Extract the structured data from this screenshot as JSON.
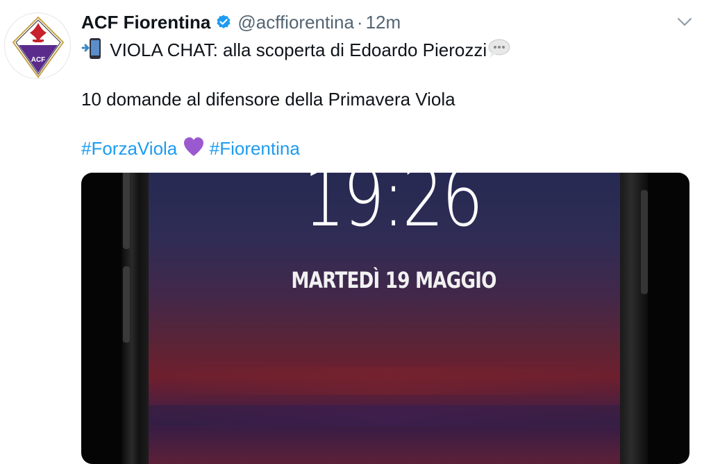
{
  "tweet": {
    "author_name": "ACF Fiorentina",
    "handle": "@acffiorentina",
    "separator": "·",
    "time": "12m",
    "line1": "VIOLA CHAT: alla scoperta di Edoardo Pierozzi",
    "line2": "10 domande al difensore della Primavera Viola",
    "hashtag1": "#ForzaViola",
    "hashtag2": "#Fiorentina"
  },
  "avatar": {
    "logo_text": "ACF"
  },
  "media": {
    "clock": "19:26",
    "date": "MARTEDÌ 19 MAGGIO"
  },
  "icons": {
    "verified": "verified-badge-icon",
    "more": "chevron-down-icon",
    "phone_emoji": "mobile-phone-arrow-icon",
    "speech_emoji": "speech-balloon-icon",
    "heart_emoji": "purple-heart-icon"
  },
  "colors": {
    "link": "#1d9bf0",
    "secondary_text": "#536471",
    "verified": "#1d9bf0",
    "heart": "#9b59d0"
  }
}
